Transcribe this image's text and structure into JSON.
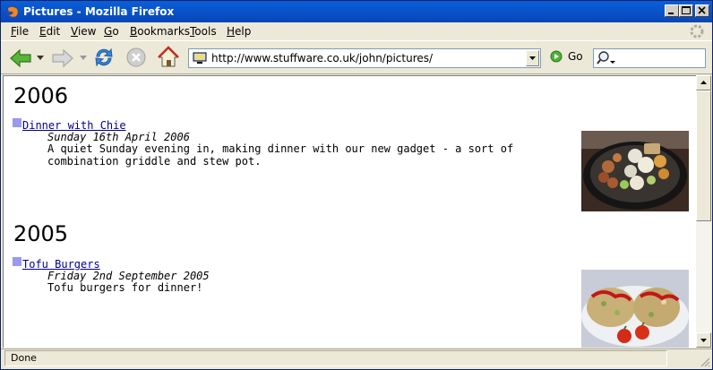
{
  "window": {
    "title": "Pictures - Mozilla Firefox"
  },
  "menu": {
    "items": [
      {
        "label": "File",
        "accel": "F",
        "rest": "ile"
      },
      {
        "label": "Edit",
        "accel": "E",
        "rest": "dit"
      },
      {
        "label": "View",
        "accel": "V",
        "rest": "iew"
      },
      {
        "label": "Go",
        "accel": "G",
        "rest": "o"
      },
      {
        "label": "Bookmarks",
        "accel": "B",
        "rest": "ookmarks"
      },
      {
        "label": "Tools",
        "accel": "T",
        "rest": "ools"
      },
      {
        "label": "Help",
        "accel": "H",
        "rest": "elp"
      }
    ]
  },
  "toolbar": {
    "url": "http://www.stuffware.co.uk/john/pictures/",
    "go_label": "Go",
    "search_placeholder": ""
  },
  "content": {
    "sections": [
      {
        "year": "2006",
        "entries": [
          {
            "title": "Dinner with Chie",
            "date": "Sunday 16th April 2006",
            "description": "A quiet Sunday evening in, making dinner with our new gadget - a sort of combination griddle and stew pot."
          }
        ]
      },
      {
        "year": "2005",
        "entries": [
          {
            "title": "Tofu Burgers",
            "date": "Friday 2nd September 2005",
            "description": "Tofu burgers for dinner!"
          }
        ]
      }
    ]
  },
  "status": {
    "text": "Done"
  },
  "colors": {
    "titlebar": "#0a5fd8",
    "link": "#00008b",
    "bullet": "#9999ee"
  }
}
